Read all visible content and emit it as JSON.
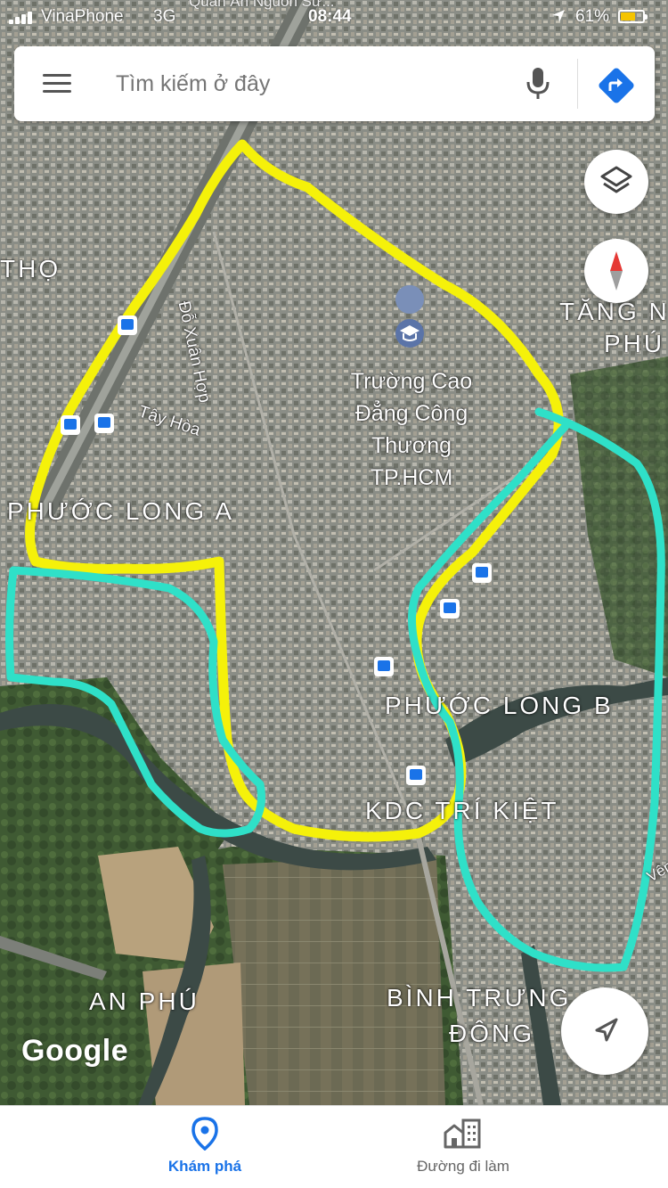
{
  "status_bar": {
    "carrier": "VinaPhone",
    "network": "3G",
    "banner": "Quán Ăn Nguồn Sư...",
    "time": "08:44",
    "battery": "61%"
  },
  "search": {
    "placeholder": "Tìm kiếm ở đây"
  },
  "map": {
    "labels": {
      "area_tho": "THỌ",
      "area_tang_nhon_phu_1": "TĂNG N",
      "area_tang_nhon_phu_2": "PHÚ",
      "area_phuoc_long_a": "PHƯỚC LONG A",
      "area_phuoc_long_b": "PHƯỚC LONG B",
      "area_kdc_tri_kiet": "KDC TRÍ KIỆT",
      "area_an_phu": "AN PHÚ",
      "area_binh_trung_1": "BÌNH TRƯNG",
      "area_binh_trung_2": "ĐÔNG",
      "street_do_xuan_hop": "Đỗ Xuân Hợp",
      "street_tay_hoa": "Tây Hòa",
      "street_edge": "Vên",
      "poi_college_line1": "Trường Cao",
      "poi_college_line2": "Đẳng Công",
      "poi_college_line3": "Thương",
      "poi_college_line4": "TP.HCM"
    },
    "google_logo": "Google",
    "overlay_colors": {
      "yellow_outline": "#f5f10a",
      "cyan_outline": "#2fe0c8"
    }
  },
  "bottom_nav": {
    "explore": "Khám phá",
    "commute": "Đường đi làm"
  },
  "colors": {
    "accent_blue": "#1a73e8",
    "compass_red": "#e53935"
  }
}
